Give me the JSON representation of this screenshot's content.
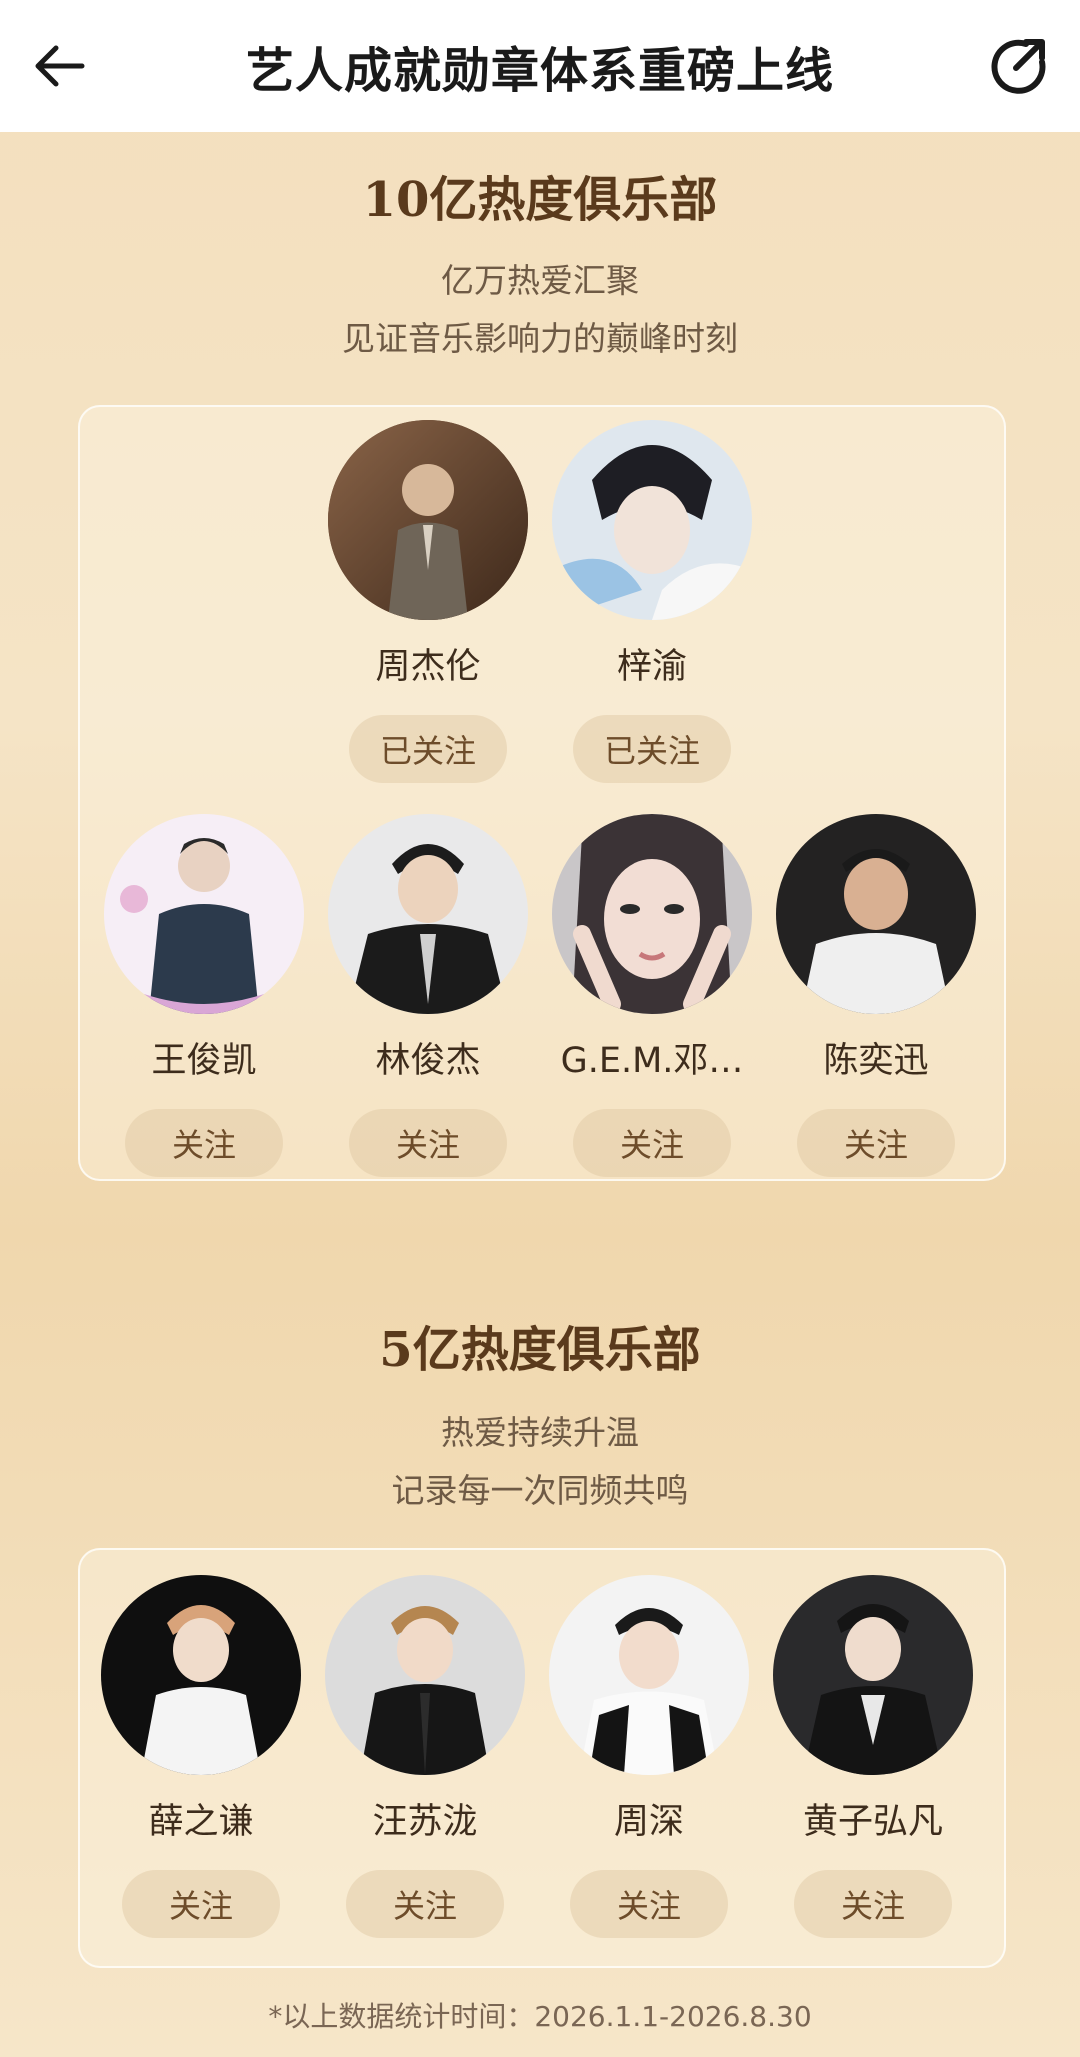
{
  "header": {
    "title": "艺人成就勋章体系重磅上线",
    "back_icon": "arrow-left-icon",
    "share_icon": "share-icon"
  },
  "club1": {
    "title": "10亿热度俱乐部",
    "subtitle_line1": "亿万热爱汇聚",
    "subtitle_line2": "见证音乐影响力的巅峰时刻",
    "artists": [
      {
        "name": "周杰伦",
        "button": "已关注"
      },
      {
        "name": "梓渝",
        "button": "已关注"
      },
      {
        "name": "王俊凯",
        "button": "关注"
      },
      {
        "name": "林俊杰",
        "button": "关注"
      },
      {
        "name": "G.E.M.邓…",
        "button": "关注"
      },
      {
        "name": "陈奕迅",
        "button": "关注"
      }
    ]
  },
  "club2": {
    "title": "5亿热度俱乐部",
    "subtitle_line1": "热爱持续升温",
    "subtitle_line2": "记录每一次同频共鸣",
    "artists": [
      {
        "name": "薛之谦",
        "button": "关注"
      },
      {
        "name": "汪苏泷",
        "button": "关注"
      },
      {
        "name": "周深",
        "button": "关注"
      },
      {
        "name": "黄子弘凡",
        "button": "关注"
      }
    ]
  },
  "footnote": "*以上数据统计时间：2026.1.1-2026.8.30"
}
